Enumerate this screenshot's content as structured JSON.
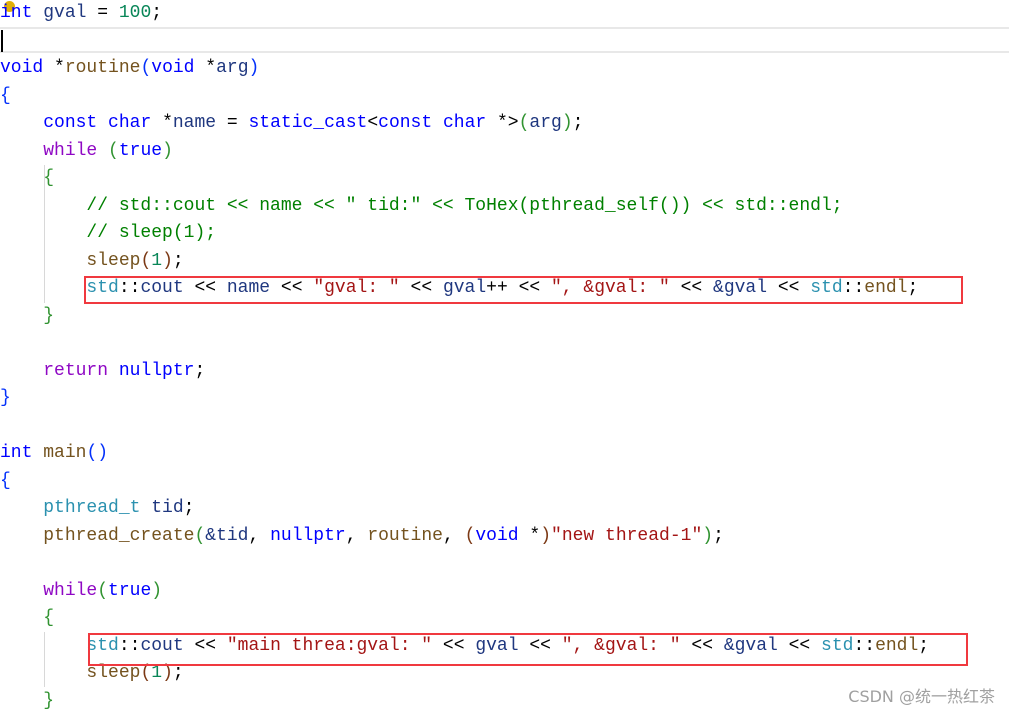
{
  "editor": {
    "lines": [
      [
        [
          "int",
          "kw"
        ],
        [
          " ",
          "pl"
        ],
        [
          "gval",
          "var"
        ],
        [
          " = ",
          "pl"
        ],
        [
          "100",
          "num"
        ],
        [
          ";",
          "pl"
        ]
      ],
      [],
      [
        [
          "void",
          "kw"
        ],
        [
          " *",
          "pl"
        ],
        [
          "routine",
          "fn"
        ],
        [
          "(",
          "b1"
        ],
        [
          "void",
          "kw"
        ],
        [
          " *",
          "pl"
        ],
        [
          "arg",
          "var"
        ],
        [
          ")",
          "b1"
        ]
      ],
      [
        [
          "{",
          "b1"
        ]
      ],
      [
        [
          "    ",
          "pl"
        ],
        [
          "const",
          "kw"
        ],
        [
          " ",
          "pl"
        ],
        [
          "char",
          "kw"
        ],
        [
          " *",
          "pl"
        ],
        [
          "name",
          "var"
        ],
        [
          " = ",
          "pl"
        ],
        [
          "static_cast",
          "kw"
        ],
        [
          "<",
          "pl"
        ],
        [
          "const",
          "kw"
        ],
        [
          " ",
          "pl"
        ],
        [
          "char",
          "kw"
        ],
        [
          " *>",
          "pl"
        ],
        [
          "(",
          "b2"
        ],
        [
          "arg",
          "var"
        ],
        [
          ")",
          "b2"
        ],
        [
          ";",
          "pl"
        ]
      ],
      [
        [
          "    ",
          "pl"
        ],
        [
          "while",
          "ctl"
        ],
        [
          " ",
          "pl"
        ],
        [
          "(",
          "b2"
        ],
        [
          "true",
          "kw"
        ],
        [
          ")",
          "b2"
        ]
      ],
      [
        [
          "    ",
          "pl"
        ],
        [
          "{",
          "b2"
        ]
      ],
      [
        [
          "        ",
          "pl"
        ],
        [
          "// std::cout << name << \" tid:\" << ToHex(pthread_self()) << std::endl;",
          "cm"
        ]
      ],
      [
        [
          "        ",
          "pl"
        ],
        [
          "// sleep(1);",
          "cm"
        ]
      ],
      [
        [
          "        ",
          "pl"
        ],
        [
          "sleep",
          "fn"
        ],
        [
          "(",
          "b3"
        ],
        [
          "1",
          "num"
        ],
        [
          ")",
          "b3"
        ],
        [
          ";",
          "pl"
        ]
      ],
      [
        [
          "        ",
          "pl"
        ],
        [
          "std",
          "ty"
        ],
        [
          "::",
          "pl"
        ],
        [
          "cout",
          "var"
        ],
        [
          " << ",
          "pl"
        ],
        [
          "name",
          "var"
        ],
        [
          " << ",
          "pl"
        ],
        [
          "\"gval: \"",
          "str"
        ],
        [
          " << ",
          "pl"
        ],
        [
          "gval",
          "var"
        ],
        [
          "++ << ",
          "pl"
        ],
        [
          "\", &gval: \"",
          "str"
        ],
        [
          " << ",
          "pl"
        ],
        [
          "&gval",
          "var"
        ],
        [
          " << ",
          "pl"
        ],
        [
          "std",
          "ty"
        ],
        [
          "::",
          "pl"
        ],
        [
          "endl",
          "fn"
        ],
        [
          ";",
          "pl"
        ]
      ],
      [
        [
          "    ",
          "pl"
        ],
        [
          "}",
          "b2"
        ]
      ],
      [],
      [
        [
          "    ",
          "pl"
        ],
        [
          "return",
          "ctl"
        ],
        [
          " ",
          "pl"
        ],
        [
          "nullptr",
          "kw"
        ],
        [
          ";",
          "pl"
        ]
      ],
      [
        [
          "}",
          "b1"
        ]
      ],
      [],
      [
        [
          "int",
          "kw"
        ],
        [
          " ",
          "pl"
        ],
        [
          "main",
          "fn"
        ],
        [
          "()",
          "b1"
        ]
      ],
      [
        [
          "{",
          "b1"
        ]
      ],
      [
        [
          "    ",
          "pl"
        ],
        [
          "pthread_t",
          "ty"
        ],
        [
          " ",
          "pl"
        ],
        [
          "tid",
          "var"
        ],
        [
          ";",
          "pl"
        ]
      ],
      [
        [
          "    ",
          "pl"
        ],
        [
          "pthread_create",
          "fn"
        ],
        [
          "(",
          "b2"
        ],
        [
          "&tid",
          "var"
        ],
        [
          ", ",
          "pl"
        ],
        [
          "nullptr",
          "kw"
        ],
        [
          ", ",
          "pl"
        ],
        [
          "routine",
          "fn"
        ],
        [
          ", ",
          "pl"
        ],
        [
          "(",
          "b3"
        ],
        [
          "void",
          "kw"
        ],
        [
          " *",
          "pl"
        ],
        [
          ")",
          "b3"
        ],
        [
          "\"new thread-1\"",
          "str"
        ],
        [
          ")",
          "b2"
        ],
        [
          ";",
          "pl"
        ]
      ],
      [],
      [
        [
          "    ",
          "pl"
        ],
        [
          "while",
          "ctl"
        ],
        [
          "(",
          "b2"
        ],
        [
          "true",
          "kw"
        ],
        [
          ")",
          "b2"
        ]
      ],
      [
        [
          "    ",
          "pl"
        ],
        [
          "{",
          "b2"
        ]
      ],
      [
        [
          "        ",
          "pl"
        ],
        [
          "std",
          "ty"
        ],
        [
          "::",
          "pl"
        ],
        [
          "cout",
          "var"
        ],
        [
          " << ",
          "pl"
        ],
        [
          "\"main threa:gval: \"",
          "str"
        ],
        [
          " << ",
          "pl"
        ],
        [
          "gval",
          "var"
        ],
        [
          " << ",
          "pl"
        ],
        [
          "\", &gval: \"",
          "str"
        ],
        [
          " << ",
          "pl"
        ],
        [
          "&gval",
          "var"
        ],
        [
          " << ",
          "pl"
        ],
        [
          "std",
          "ty"
        ],
        [
          "::",
          "pl"
        ],
        [
          "endl",
          "fn"
        ],
        [
          ";",
          "pl"
        ]
      ],
      [
        [
          "        ",
          "pl"
        ],
        [
          "sleep",
          "fn"
        ],
        [
          "(",
          "b3"
        ],
        [
          "1",
          "num"
        ],
        [
          ")",
          "b3"
        ],
        [
          ";",
          "pl"
        ]
      ],
      [
        [
          "    ",
          "pl"
        ],
        [
          "}",
          "b2"
        ]
      ]
    ]
  },
  "watermark": "CSDN @统一热红茶",
  "colors": {
    "highlight_box": "#f0393f",
    "keyword": "#0000ff",
    "control": "#8f08c4",
    "function": "#74531f",
    "string": "#a31515",
    "comment": "#008000",
    "number": "#098658",
    "type": "#2b91af"
  }
}
